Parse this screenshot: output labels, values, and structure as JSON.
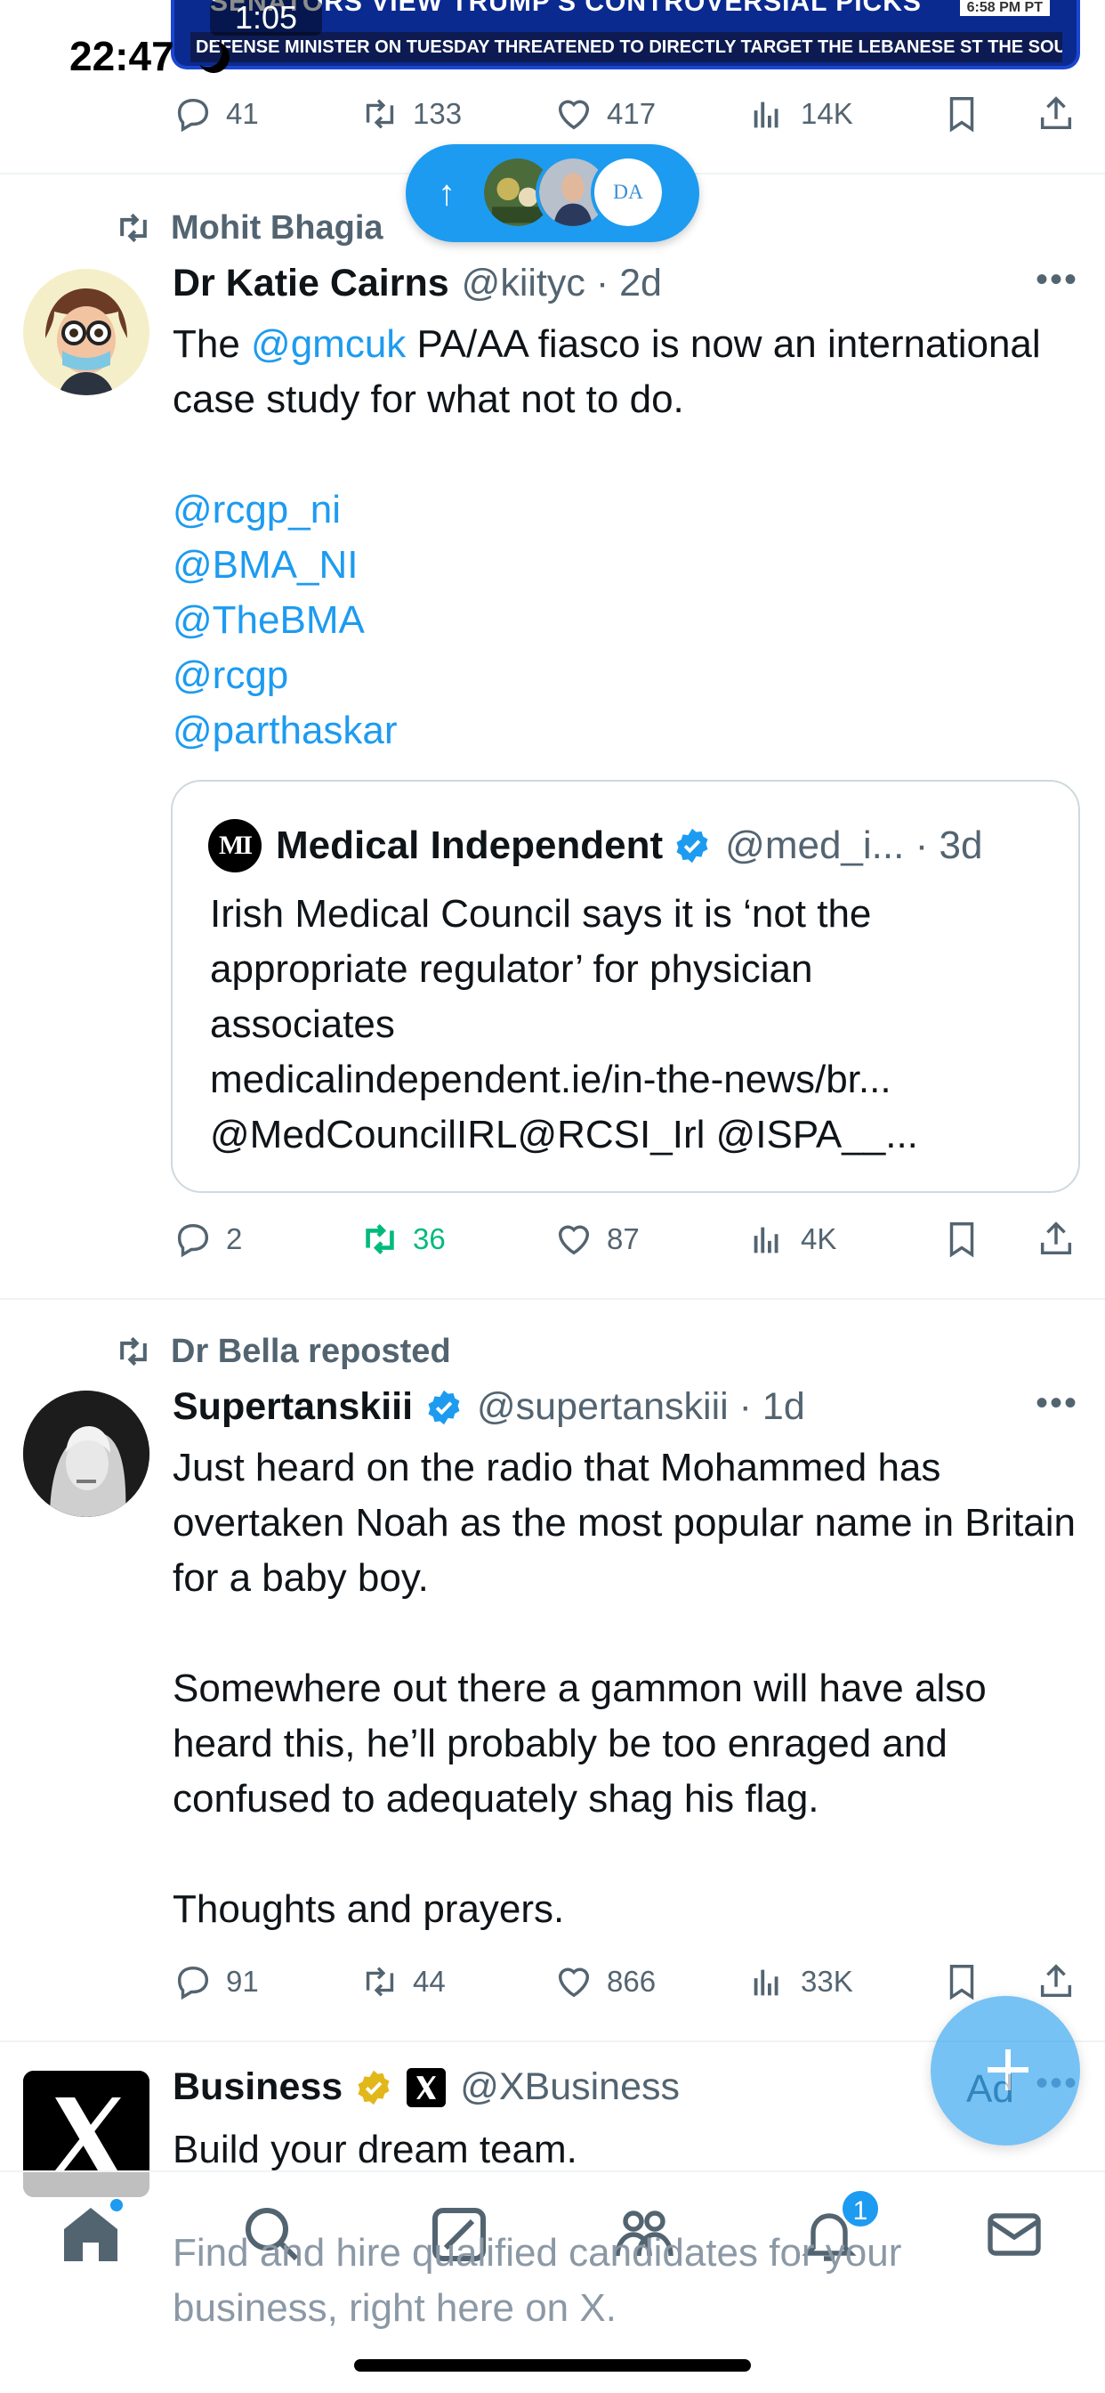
{
  "status_bar": {
    "time": "22:47",
    "video": {
      "headline": "SENATORS VIEW TRUMP'S CONTROVERSIAL PICKS",
      "ticker": "DEFENSE MINISTER ON TUESDAY THREATENED TO DIRECTLY TARGET THE LEBANESE ST THE SOURCE",
      "elapsed": "1:05",
      "timestamp": "6:58 PM PT"
    }
  },
  "top_actions": {
    "replies": "41",
    "reposts": "133",
    "likes": "417",
    "views": "14K"
  },
  "new_posts_pill": {
    "icon": "arrow-up-icon"
  },
  "tweet1": {
    "repost_by": "Mohit Bhagia",
    "name": "Dr Katie Cairns",
    "handle": "@kiityc",
    "time": "2d",
    "text_pre": "The ",
    "mention1": "@gmcuk",
    "text_post": " PA/AA fiasco is now an international case study for what not to do.",
    "mentions": [
      "@rcgp_ni",
      "@BMA_NI",
      "@TheBMA",
      "@rcgp",
      "@parthaskar"
    ],
    "quote": {
      "logo": "MI",
      "name": "Medical Independent",
      "handle": "@med_i...",
      "time": "3d",
      "text_lines": [
        "Irish Medical Council says it is ‘not the",
        "appropriate regulator’ for physician",
        "associates",
        "medicalindependent.ie/in-the-news/br...",
        "@MedCouncilIRL@RCSI_Irl @ISPA__..."
      ]
    },
    "actions": {
      "replies": "2",
      "reposts": "36",
      "likes": "87",
      "views": "4K"
    }
  },
  "tweet2": {
    "repost_by": "Dr Bella reposted",
    "name": "Supertanskiii",
    "handle": "@supertanskiii",
    "time": "1d",
    "paragraphs": [
      "Just heard on the radio that Mohammed has overtaken Noah as the most popular name in Britain for a baby boy.",
      "Somewhere out there a gammon will have also heard this, he’ll probably be too enraged and confused to adequately shag his flag.",
      "Thoughts and prayers."
    ],
    "actions": {
      "replies": "91",
      "reposts": "44",
      "likes": "866",
      "views": "33K"
    }
  },
  "ad_tweet": {
    "name": "Business",
    "handle": "@XBusiness",
    "headline": "Build your dream team.",
    "description": "Find and hire qualified candidates for your business, right here on X.",
    "ad_label": "Ad"
  },
  "tab_bar": {
    "items": [
      "home-icon",
      "search-icon",
      "grok-icon",
      "communities-icon",
      "notifications-icon",
      "messages-icon"
    ],
    "notification_count": "1"
  },
  "colors": {
    "accent": "#1d9bf0",
    "green": "#00ba7c",
    "secondary_text": "#536471",
    "gold": "#e2b719"
  }
}
